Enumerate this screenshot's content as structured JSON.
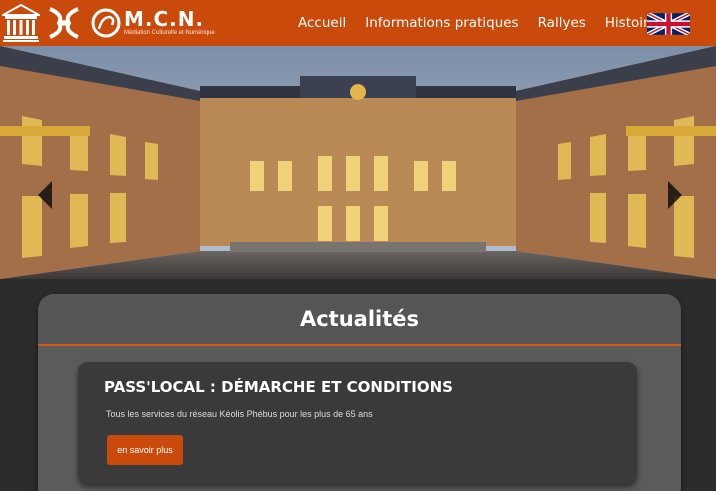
{
  "header": {
    "logo_title": "M.C.N.",
    "logo_subtitle": "Médiation Culturelle et Numérique",
    "nav": [
      {
        "label": "Accueil"
      },
      {
        "label": "Informations pratiques"
      },
      {
        "label": "Rallyes"
      },
      {
        "label": "Histoire"
      }
    ],
    "language_flag": "uk-flag-icon"
  },
  "hero": {
    "prev_icon": "chevron-left-icon",
    "next_icon": "chevron-right-icon"
  },
  "news": {
    "title": "Actualités",
    "items": [
      {
        "title": "PASS'LOCAL : DÉMARCHE ET CONDITIONS",
        "description": "Tous les services du réseau Kéolis Phébus pour les plus de 65 ans",
        "button_label": "en savoir plus"
      }
    ]
  },
  "colors": {
    "brand_orange": "#c94a0b",
    "page_bg": "#2c2c2c",
    "panel_bg": "#5b5b5b",
    "card_bg": "#3a3a3a"
  }
}
